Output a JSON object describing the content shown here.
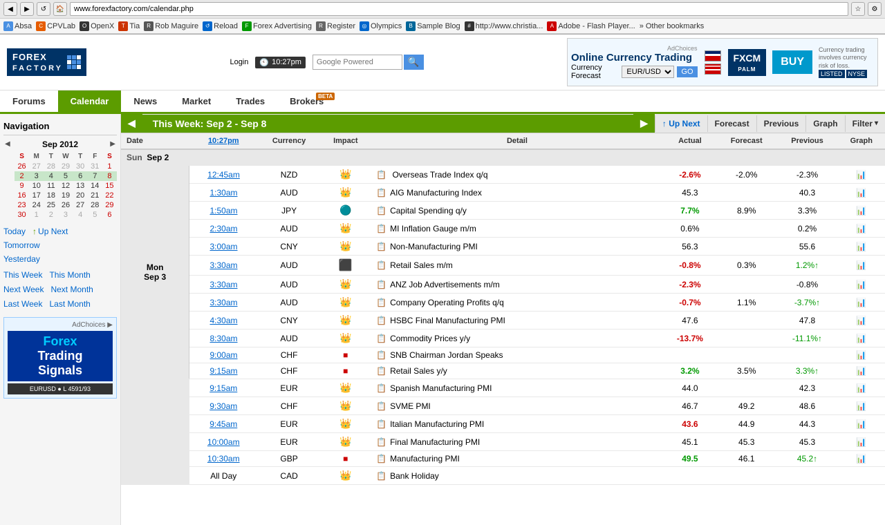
{
  "browser": {
    "address": "www.forexfactory.com/calendar.php",
    "bookmarks": [
      {
        "label": "Absa",
        "icon": "A"
      },
      {
        "label": "CPVLab",
        "icon": "C"
      },
      {
        "label": "OpenX",
        "icon": "O"
      },
      {
        "label": "Tia",
        "icon": "T"
      },
      {
        "label": "Rob Maguire",
        "icon": "R"
      },
      {
        "label": "Reload",
        "icon": "↺"
      },
      {
        "label": "Forex Advertising",
        "icon": "F"
      },
      {
        "label": "Register",
        "icon": "R"
      },
      {
        "label": "Olympics",
        "icon": "◎"
      },
      {
        "label": "Sample Blog",
        "icon": "B"
      },
      {
        "label": "http://www.christia...",
        "icon": "#"
      },
      {
        "label": "Adobe - Flash Player...",
        "icon": "A"
      },
      {
        "label": "Other bookmarks",
        "icon": "»"
      }
    ]
  },
  "site": {
    "logo_text": "FOREX FACTORY",
    "time": "10:27pm",
    "search_placeholder": "Google Powered",
    "login_label": "Login"
  },
  "nav": {
    "items": [
      {
        "label": "Forums",
        "active": false
      },
      {
        "label": "Calendar",
        "active": true
      },
      {
        "label": "News",
        "active": false
      },
      {
        "label": "Market",
        "active": false
      },
      {
        "label": "Trades",
        "active": false
      },
      {
        "label": "Brokers",
        "active": false,
        "beta": true
      }
    ]
  },
  "ad": {
    "title": "Online Currency Trading",
    "subtitle": "Currency Forecast",
    "pair": "EUR/USD",
    "go_label": "GO",
    "company": "FXCM",
    "tagline": "Currency trading involves\ncurrency risk of loss.",
    "exchange": "NYSE",
    "listed_label": "LISTED",
    "buy_label": "BUY",
    "adchoices": "AdChoices"
  },
  "sidebar": {
    "title": "Navigation",
    "calendar": {
      "month_year": "Sep 2012",
      "day_headers": [
        "S",
        "M",
        "T",
        "W",
        "T",
        "F",
        "S"
      ],
      "weeks": [
        {
          "num": "",
          "days": [
            {
              "d": "26",
              "other": true
            },
            {
              "d": "27",
              "other": true
            },
            {
              "d": "28",
              "other": true
            },
            {
              "d": "29",
              "other": true
            },
            {
              "d": "30",
              "other": true
            },
            {
              "d": "31",
              "other": true
            },
            {
              "d": "1",
              "other": false
            }
          ]
        },
        {
          "num": "",
          "days": [
            {
              "d": "2",
              "today": false,
              "sel": true
            },
            {
              "d": "3",
              "sel": true
            },
            {
              "d": "4",
              "sel": true
            },
            {
              "d": "5",
              "sel": true
            },
            {
              "d": "6",
              "sel": true
            },
            {
              "d": "7",
              "sel": true
            },
            {
              "d": "8",
              "sel": true
            }
          ]
        },
        {
          "num": "",
          "days": [
            {
              "d": "9"
            },
            {
              "d": "10"
            },
            {
              "d": "11"
            },
            {
              "d": "12"
            },
            {
              "d": "13"
            },
            {
              "d": "14"
            },
            {
              "d": "15"
            }
          ]
        },
        {
          "num": "",
          "days": [
            {
              "d": "16"
            },
            {
              "d": "17"
            },
            {
              "d": "18"
            },
            {
              "d": "19"
            },
            {
              "d": "20"
            },
            {
              "d": "21"
            },
            {
              "d": "22"
            }
          ]
        },
        {
          "num": "",
          "days": [
            {
              "d": "23"
            },
            {
              "d": "24"
            },
            {
              "d": "25"
            },
            {
              "d": "26"
            },
            {
              "d": "27"
            },
            {
              "d": "28"
            },
            {
              "d": "29"
            }
          ]
        },
        {
          "num": "",
          "days": [
            {
              "d": "30"
            },
            {
              "d": "1",
              "other": true
            },
            {
              "d": "2",
              "other": true
            },
            {
              "d": "3",
              "other": true
            },
            {
              "d": "4",
              "other": true
            },
            {
              "d": "5",
              "other": true
            },
            {
              "d": "6",
              "other": true
            }
          ]
        }
      ]
    },
    "quick_links": [
      {
        "label": "Today",
        "bold": true
      },
      {
        "label": "↑ Up Next"
      },
      {
        "label": "Tomorrow"
      },
      {
        "label": "Yesterday"
      }
    ],
    "week_links": [
      {
        "label": "This Week"
      },
      {
        "label": "This Month"
      }
    ],
    "week_links2": [
      {
        "label": "Next Week"
      },
      {
        "label": "Next Month"
      }
    ],
    "week_links3": [
      {
        "label": "Last Week"
      },
      {
        "label": "Last Month"
      }
    ]
  },
  "calendar": {
    "week_title": "This Week: Sep 2 - Sep 8",
    "col_headers": {
      "date": "Date",
      "time": "10:27pm",
      "currency": "Currency",
      "impact": "Impact",
      "detail": "Detail",
      "actual": "Actual",
      "forecast": "Forecast",
      "previous": "Previous",
      "graph": "Graph"
    },
    "actions": [
      {
        "label": "↑ Up Next"
      },
      {
        "label": "Forecast"
      },
      {
        "label": "Previous"
      },
      {
        "label": "Graph"
      }
    ],
    "filter_label": "Filter ▾",
    "rows": [
      {
        "type": "day",
        "day": "Sun",
        "date": "Sep 2"
      },
      {
        "type": "event",
        "time": "",
        "currency": "NZD",
        "impact": "low",
        "event": "Overseas Trade Index q/q",
        "actual": "-2.6%",
        "actual_class": "actual-red",
        "forecast": "-2.0%",
        "previous": "-2.3%",
        "previous_class": ""
      },
      {
        "type": "event",
        "time": "1:30am",
        "currency": "AUD",
        "impact": "low",
        "event": "AIG Manufacturing Index",
        "actual": "45.3",
        "actual_class": "",
        "forecast": "",
        "previous": "40.3",
        "previous_class": ""
      },
      {
        "type": "event",
        "time": "1:50am",
        "currency": "JPY",
        "impact": "med",
        "event": "Capital Spending q/y",
        "actual": "7.7%",
        "actual_class": "actual-green",
        "forecast": "8.9%",
        "previous": "3.3%",
        "previous_class": ""
      },
      {
        "type": "event",
        "time": "2:30am",
        "currency": "AUD",
        "impact": "low",
        "event": "MI Inflation Gauge m/m",
        "actual": "0.6%",
        "actual_class": "",
        "forecast": "",
        "previous": "0.2%",
        "previous_class": ""
      },
      {
        "type": "event",
        "time": "3:00am",
        "currency": "CNY",
        "impact": "low",
        "event": "Non-Manufacturing PMI",
        "actual": "56.3",
        "actual_class": "",
        "forecast": "",
        "previous": "55.6",
        "previous_class": ""
      },
      {
        "type": "event",
        "time": "3:30am",
        "currency": "AUD",
        "impact": "high",
        "event": "Retail Sales m/m",
        "actual": "-0.8%",
        "actual_class": "actual-red",
        "forecast": "0.3%",
        "previous": "1.2%↑",
        "previous_class": "previous-arrow-up"
      },
      {
        "type": "event",
        "time": "3:30am",
        "currency": "AUD",
        "impact": "med",
        "event": "ANZ Job Advertisements m/m",
        "actual": "-2.3%",
        "actual_class": "actual-red",
        "forecast": "",
        "previous": "-0.8%",
        "previous_class": ""
      },
      {
        "type": "event",
        "time": "3:30am",
        "currency": "AUD",
        "impact": "med",
        "event": "Company Operating Profits q/q",
        "actual": "-0.7%",
        "actual_class": "actual-red",
        "forecast": "1.1%",
        "previous": "-3.7%↑",
        "previous_class": "previous-arrow-up"
      },
      {
        "type": "event",
        "time": "4:30am",
        "currency": "CNY",
        "impact": "med",
        "event": "HSBC Final Manufacturing PMI",
        "actual": "47.6",
        "actual_class": "",
        "forecast": "",
        "previous": "47.8",
        "previous_class": ""
      },
      {
        "type": "event",
        "time": "8:30am",
        "currency": "AUD",
        "impact": "low",
        "event": "Commodity Prices y/y",
        "actual": "-13.7%",
        "actual_class": "actual-red",
        "forecast": "",
        "previous": "-11.1%↑",
        "previous_class": "previous-arrow-up"
      },
      {
        "type": "event",
        "time": "9:00am",
        "currency": "CHF",
        "impact": "high",
        "event": "SNB Chairman Jordan Speaks",
        "actual": "",
        "actual_class": "",
        "forecast": "",
        "previous": "",
        "previous_class": ""
      },
      {
        "type": "event",
        "time": "9:15am",
        "currency": "CHF",
        "impact": "high",
        "event": "Retail Sales y/y",
        "actual": "3.2%",
        "actual_class": "actual-green",
        "forecast": "3.5%",
        "previous": "3.3%↑",
        "previous_class": "previous-arrow-up"
      },
      {
        "type": "event",
        "time": "9:15am",
        "currency": "EUR",
        "impact": "med",
        "event": "Spanish Manufacturing PMI",
        "actual": "44.0",
        "actual_class": "",
        "forecast": "",
        "previous": "42.3",
        "previous_class": ""
      },
      {
        "type": "event",
        "time": "9:30am",
        "currency": "CHF",
        "impact": "med",
        "event": "SVME PMI",
        "actual": "46.7",
        "actual_class": "",
        "forecast": "49.2",
        "previous": "48.6",
        "previous_class": ""
      },
      {
        "type": "event",
        "time": "9:45am",
        "currency": "EUR",
        "impact": "med",
        "event": "Italian Manufacturing PMI",
        "actual": "43.6",
        "actual_class": "actual-red",
        "forecast": "44.9",
        "previous": "44.3",
        "previous_class": ""
      },
      {
        "type": "event",
        "time": "10:00am",
        "currency": "EUR",
        "impact": "med",
        "event": "Final Manufacturing PMI",
        "actual": "45.1",
        "actual_class": "",
        "forecast": "45.3",
        "previous": "45.3",
        "previous_class": ""
      },
      {
        "type": "event",
        "time": "10:30am",
        "currency": "GBP",
        "impact": "high",
        "event": "Manufacturing PMI",
        "actual": "49.5",
        "actual_class": "actual-green",
        "forecast": "46.1",
        "previous": "45.2↑",
        "previous_class": "previous-arrow-up"
      },
      {
        "type": "event",
        "time": "All Day",
        "currency": "CAD",
        "impact": "low",
        "event": "Bank Holiday",
        "actual": "",
        "actual_class": "",
        "forecast": "",
        "previous": "",
        "previous_class": ""
      }
    ]
  }
}
